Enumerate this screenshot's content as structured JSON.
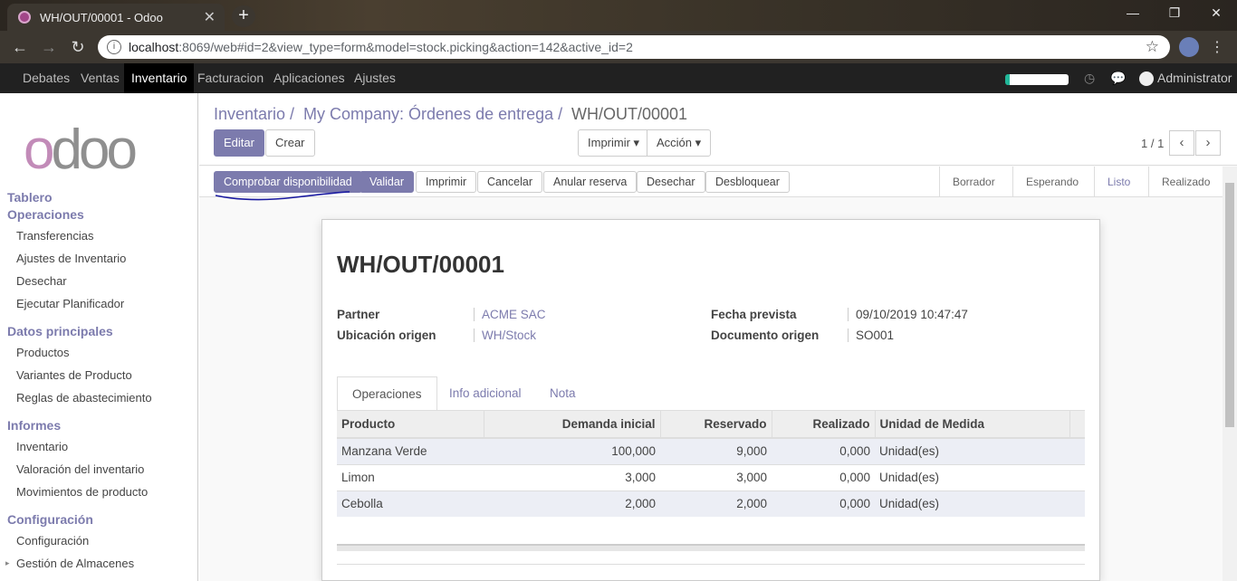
{
  "browser": {
    "tab_title": "WH/OUT/00001 - Odoo",
    "url_host": "localhost",
    "url_rest": ":8069/web#id=2&view_type=form&model=stock.picking&action=142&active_id=2"
  },
  "topbar": {
    "menu": [
      "Debates",
      "Ventas",
      "Inventario",
      "Facturacion",
      "Aplicaciones",
      "Ajustes"
    ],
    "active": "Inventario",
    "user": "Administrator"
  },
  "sidebar": {
    "logo": "odoo",
    "sections": [
      {
        "title": "Tablero",
        "items": []
      },
      {
        "title": "Operaciones",
        "items": [
          "Transferencias",
          "Ajustes de Inventario",
          "Desechar",
          "Ejecutar Planificador"
        ]
      },
      {
        "title": "Datos principales",
        "items": [
          "Productos",
          "Variantes de Producto",
          "Reglas de abastecimiento"
        ]
      },
      {
        "title": "Informes",
        "items": [
          "Inventario",
          "Valoración del inventario",
          "Movimientos de producto"
        ]
      },
      {
        "title": "Configuración",
        "items": [
          "Configuración",
          "Gestión de Almacenes"
        ]
      }
    ]
  },
  "breadcrumb": {
    "b1": "Inventario /",
    "b2": "My Company: Órdenes de entrega /",
    "b3": "WH/OUT/00001"
  },
  "cp": {
    "edit": "Editar",
    "create": "Crear",
    "print": "Imprimir ▾",
    "action": "Acción ▾",
    "pager": "1 / 1"
  },
  "statusbar": {
    "buttons": [
      "Comprobar disponibilidad",
      "Validar",
      "Imprimir",
      "Cancelar",
      "Anular reserva",
      "Desechar",
      "Desbloquear"
    ],
    "stages": [
      "Borrador",
      "Esperando",
      "Listo",
      "Realizado"
    ],
    "current": "Listo"
  },
  "record": {
    "name": "WH/OUT/00001",
    "partner_label": "Partner",
    "partner": "ACME SAC",
    "location_label": "Ubicación origen",
    "location": "WH/Stock",
    "date_label": "Fecha prevista",
    "date": "09/10/2019 10:47:47",
    "origin_label": "Documento origen",
    "origin": "SO001"
  },
  "tabs": [
    "Operaciones",
    "Info adicional",
    "Nota"
  ],
  "table": {
    "headers": [
      "Producto",
      "Demanda inicial",
      "Reservado",
      "Realizado",
      "Unidad de Medida"
    ],
    "rows": [
      [
        "Manzana Verde",
        "100,000",
        "9,000",
        "0,000",
        "Unidad(es)"
      ],
      [
        "Limon",
        "3,000",
        "3,000",
        "0,000",
        "Unidad(es)"
      ],
      [
        "Cebolla",
        "2,000",
        "2,000",
        "0,000",
        "Unidad(es)"
      ]
    ]
  }
}
